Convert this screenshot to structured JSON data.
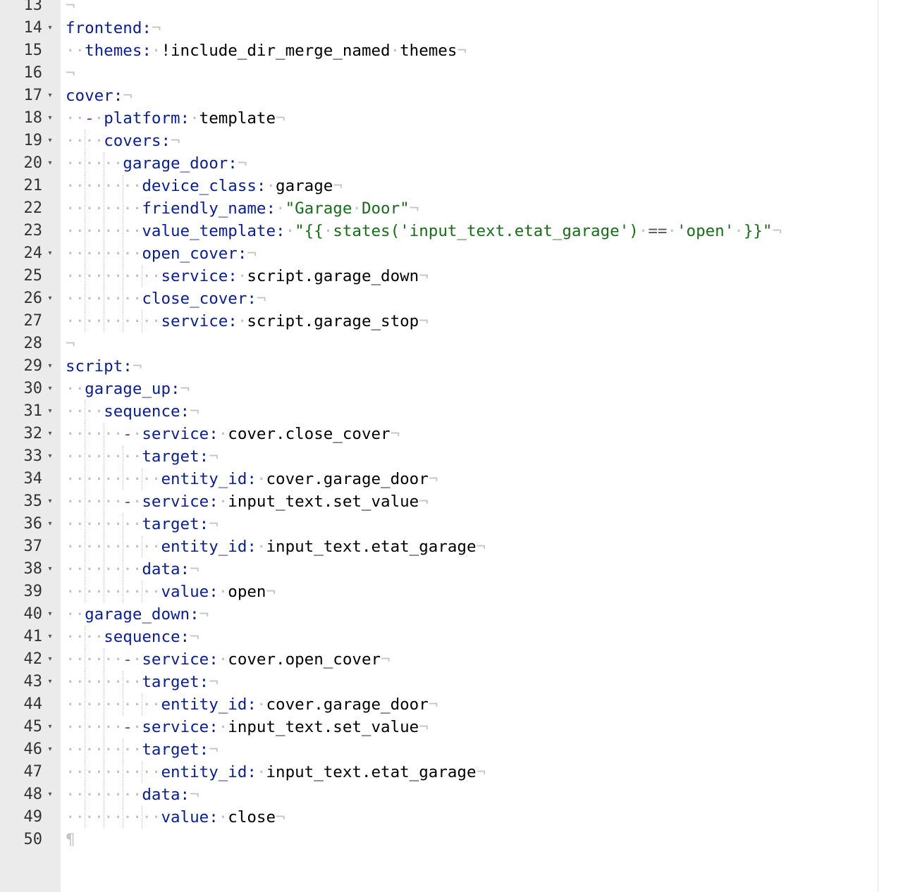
{
  "editor": {
    "language": "yaml",
    "lines": [
      {
        "n": "13",
        "fold": false,
        "tokens": []
      },
      {
        "n": "14",
        "fold": true,
        "tokens": [
          [
            "key",
            "frontend:"
          ]
        ]
      },
      {
        "n": "15",
        "fold": false,
        "tokens": [
          [
            "ws",
            "··"
          ],
          [
            "key",
            "themes:"
          ],
          [
            "ws",
            "·"
          ],
          [
            "plain",
            "!include_dir_merge_named"
          ],
          [
            "ws",
            "·"
          ],
          [
            "plain",
            "themes"
          ]
        ]
      },
      {
        "n": "16",
        "fold": false,
        "tokens": []
      },
      {
        "n": "17",
        "fold": true,
        "tokens": [
          [
            "key",
            "cover:"
          ]
        ]
      },
      {
        "n": "18",
        "fold": true,
        "tokens": [
          [
            "ws",
            "··"
          ],
          [
            "dash",
            "-"
          ],
          [
            "ws",
            "·"
          ],
          [
            "key",
            "platform:"
          ],
          [
            "ws",
            "·"
          ],
          [
            "plain",
            "template"
          ]
        ]
      },
      {
        "n": "19",
        "fold": true,
        "tokens": [
          [
            "ws",
            "····"
          ],
          [
            "key",
            "covers:"
          ]
        ]
      },
      {
        "n": "20",
        "fold": true,
        "tokens": [
          [
            "ws",
            "······"
          ],
          [
            "key",
            "garage_door:"
          ]
        ]
      },
      {
        "n": "21",
        "fold": false,
        "tokens": [
          [
            "ws",
            "········"
          ],
          [
            "key",
            "device_class:"
          ],
          [
            "ws",
            "·"
          ],
          [
            "plain",
            "garage"
          ]
        ]
      },
      {
        "n": "22",
        "fold": false,
        "tokens": [
          [
            "ws",
            "········"
          ],
          [
            "key",
            "friendly_name:"
          ],
          [
            "ws",
            "·"
          ],
          [
            "str",
            "\"Garage"
          ],
          [
            "ws",
            "·"
          ],
          [
            "str",
            "Door\""
          ]
        ]
      },
      {
        "n": "23",
        "fold": false,
        "tokens": [
          [
            "ws",
            "········"
          ],
          [
            "key",
            "value_template:"
          ],
          [
            "ws",
            "·"
          ],
          [
            "str",
            "\"{{"
          ],
          [
            "ws",
            "·"
          ],
          [
            "str",
            "states('input_text.etat_garage')"
          ],
          [
            "ws",
            "·"
          ],
          [
            "op",
            "=="
          ],
          [
            "ws",
            "·"
          ],
          [
            "str",
            "'open'"
          ],
          [
            "ws",
            "·"
          ],
          [
            "str",
            "}}\""
          ]
        ]
      },
      {
        "n": "24",
        "fold": true,
        "tokens": [
          [
            "ws",
            "········"
          ],
          [
            "key",
            "open_cover:"
          ]
        ]
      },
      {
        "n": "25",
        "fold": false,
        "tokens": [
          [
            "ws",
            "··········"
          ],
          [
            "key",
            "service:"
          ],
          [
            "ws",
            "·"
          ],
          [
            "plain",
            "script.garage_down"
          ]
        ]
      },
      {
        "n": "26",
        "fold": true,
        "tokens": [
          [
            "ws",
            "········"
          ],
          [
            "key",
            "close_cover:"
          ]
        ]
      },
      {
        "n": "27",
        "fold": false,
        "tokens": [
          [
            "ws",
            "··········"
          ],
          [
            "key",
            "service:"
          ],
          [
            "ws",
            "·"
          ],
          [
            "plain",
            "script.garage_stop"
          ]
        ]
      },
      {
        "n": "28",
        "fold": false,
        "tokens": []
      },
      {
        "n": "29",
        "fold": true,
        "tokens": [
          [
            "key",
            "script:"
          ]
        ]
      },
      {
        "n": "30",
        "fold": true,
        "tokens": [
          [
            "ws",
            "··"
          ],
          [
            "key",
            "garage_up:"
          ]
        ]
      },
      {
        "n": "31",
        "fold": true,
        "tokens": [
          [
            "ws",
            "····"
          ],
          [
            "key",
            "sequence:"
          ]
        ]
      },
      {
        "n": "32",
        "fold": true,
        "tokens": [
          [
            "ws",
            "······"
          ],
          [
            "dash",
            "-"
          ],
          [
            "ws",
            "·"
          ],
          [
            "key",
            "service:"
          ],
          [
            "ws",
            "·"
          ],
          [
            "plain",
            "cover.close_cover"
          ]
        ]
      },
      {
        "n": "33",
        "fold": true,
        "tokens": [
          [
            "ws",
            "········"
          ],
          [
            "key",
            "target:"
          ]
        ]
      },
      {
        "n": "34",
        "fold": false,
        "tokens": [
          [
            "ws",
            "··········"
          ],
          [
            "key",
            "entity_id:"
          ],
          [
            "ws",
            "·"
          ],
          [
            "plain",
            "cover.garage_door"
          ]
        ]
      },
      {
        "n": "35",
        "fold": true,
        "tokens": [
          [
            "ws",
            "······"
          ],
          [
            "dash",
            "-"
          ],
          [
            "ws",
            "·"
          ],
          [
            "key",
            "service:"
          ],
          [
            "ws",
            "·"
          ],
          [
            "plain",
            "input_text.set_value"
          ]
        ]
      },
      {
        "n": "36",
        "fold": true,
        "tokens": [
          [
            "ws",
            "········"
          ],
          [
            "key",
            "target:"
          ]
        ]
      },
      {
        "n": "37",
        "fold": false,
        "tokens": [
          [
            "ws",
            "··········"
          ],
          [
            "key",
            "entity_id:"
          ],
          [
            "ws",
            "·"
          ],
          [
            "plain",
            "input_text.etat_garage"
          ]
        ]
      },
      {
        "n": "38",
        "fold": true,
        "tokens": [
          [
            "ws",
            "········"
          ],
          [
            "key",
            "data:"
          ]
        ]
      },
      {
        "n": "39",
        "fold": false,
        "tokens": [
          [
            "ws",
            "··········"
          ],
          [
            "key",
            "value:"
          ],
          [
            "ws",
            "·"
          ],
          [
            "plain",
            "open"
          ]
        ]
      },
      {
        "n": "40",
        "fold": true,
        "tokens": [
          [
            "ws",
            "··"
          ],
          [
            "key",
            "garage_down:"
          ]
        ]
      },
      {
        "n": "41",
        "fold": true,
        "tokens": [
          [
            "ws",
            "····"
          ],
          [
            "key",
            "sequence:"
          ]
        ]
      },
      {
        "n": "42",
        "fold": true,
        "tokens": [
          [
            "ws",
            "······"
          ],
          [
            "dash",
            "-"
          ],
          [
            "ws",
            "·"
          ],
          [
            "key",
            "service:"
          ],
          [
            "ws",
            "·"
          ],
          [
            "plain",
            "cover.open_cover"
          ]
        ]
      },
      {
        "n": "43",
        "fold": true,
        "tokens": [
          [
            "ws",
            "········"
          ],
          [
            "key",
            "target:"
          ]
        ]
      },
      {
        "n": "44",
        "fold": false,
        "tokens": [
          [
            "ws",
            "··········"
          ],
          [
            "key",
            "entity_id:"
          ],
          [
            "ws",
            "·"
          ],
          [
            "plain",
            "cover.garage_door"
          ]
        ]
      },
      {
        "n": "45",
        "fold": true,
        "tokens": [
          [
            "ws",
            "······"
          ],
          [
            "dash",
            "-"
          ],
          [
            "ws",
            "·"
          ],
          [
            "key",
            "service:"
          ],
          [
            "ws",
            "·"
          ],
          [
            "plain",
            "input_text.set_value"
          ]
        ]
      },
      {
        "n": "46",
        "fold": true,
        "tokens": [
          [
            "ws",
            "········"
          ],
          [
            "key",
            "target:"
          ]
        ]
      },
      {
        "n": "47",
        "fold": false,
        "tokens": [
          [
            "ws",
            "··········"
          ],
          [
            "key",
            "entity_id:"
          ],
          [
            "ws",
            "·"
          ],
          [
            "plain",
            "input_text.etat_garage"
          ]
        ]
      },
      {
        "n": "48",
        "fold": true,
        "tokens": [
          [
            "ws",
            "········"
          ],
          [
            "key",
            "data:"
          ]
        ]
      },
      {
        "n": "49",
        "fold": false,
        "tokens": [
          [
            "ws",
            "··········"
          ],
          [
            "key",
            "value:"
          ],
          [
            "ws",
            "·"
          ],
          [
            "plain",
            "close"
          ]
        ]
      },
      {
        "n": "50",
        "fold": false,
        "tokens": [],
        "eof": true
      }
    ]
  },
  "icons": {
    "fold": "fold-arrow-icon",
    "eol": "eol-marker-icon",
    "eof": "pilcrow-icon"
  },
  "colors": {
    "gutter": "#ebebeb",
    "key": "#0a1e8c",
    "dash": "#b0208c",
    "string": "#1a6b1a",
    "invisible": "#bfbfbf"
  }
}
